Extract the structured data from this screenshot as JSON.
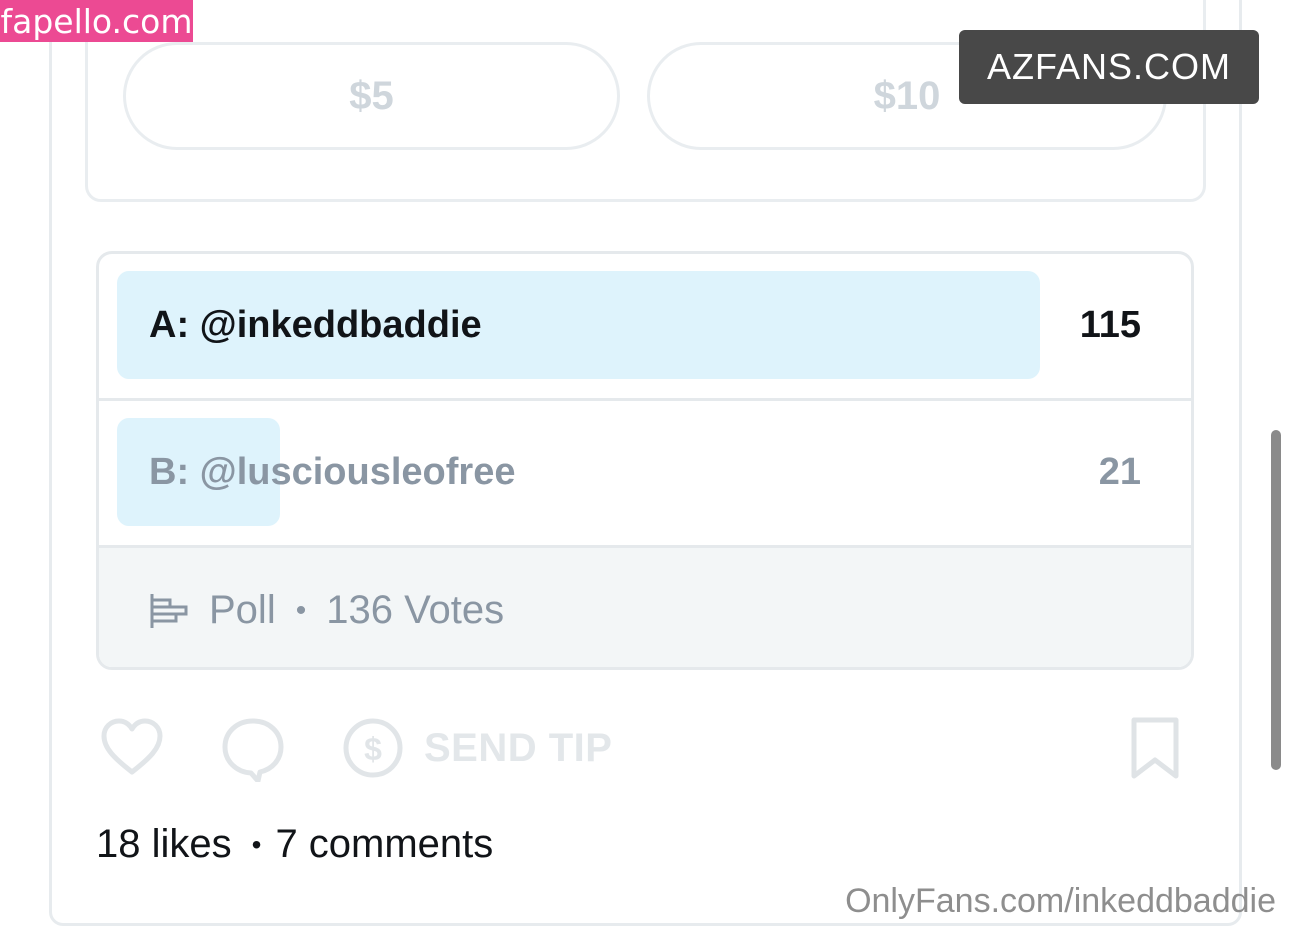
{
  "watermarks": {
    "fapello": "fapello.com",
    "azfans": "AZFANS.COM",
    "onlyfans_url": "OnlyFans.com/inkeddbaddie"
  },
  "tip_options": {
    "option1": "$5",
    "option2": "$10"
  },
  "poll": {
    "options": [
      {
        "label": "A: @inkeddbaddie",
        "votes": "115",
        "share": 0.846
      },
      {
        "label": "B: @lusciousleofree",
        "votes": "21",
        "share": 0.154
      }
    ],
    "footer": {
      "type_label": "Poll",
      "separator": "•",
      "votes_text": "136 Votes"
    }
  },
  "actions": {
    "send_tip_label": "SEND TIP",
    "icons": [
      "heart-icon",
      "comment-icon",
      "dollar-circle-icon",
      "bookmark-icon"
    ]
  },
  "stats": {
    "likes": "18 likes",
    "separator": "•",
    "comments": "7 comments"
  },
  "colors": {
    "poll_bar": "#def3fc",
    "watermark_pink": "#ec4a93",
    "muted_text": "#8a96a3"
  }
}
